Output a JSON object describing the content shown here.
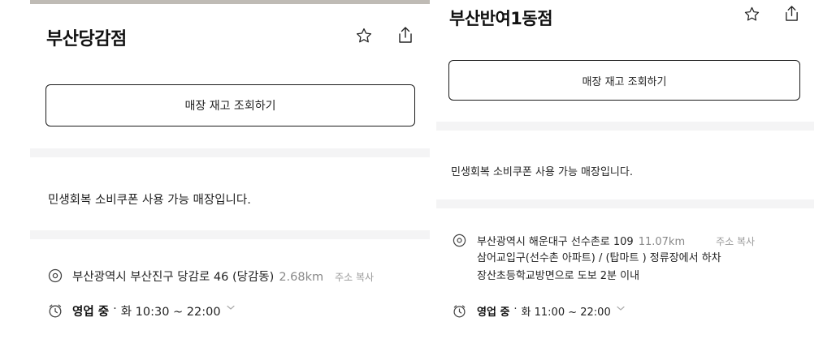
{
  "stores": [
    {
      "name": "부산당감점",
      "inventory_button": "매장 재고 조회하기",
      "coupon_notice": "민생회복 소비쿠폰 사용 가능 매장입니다.",
      "address": "부산광역시 부산진구 당감로 46 (당감동)",
      "distance": "2.68km",
      "copy_label": "주소 복사",
      "directions_1": "",
      "directions_2": "",
      "hours_status": "영업 중",
      "hours_separator": "·",
      "hours": "화 10:30 ~ 22:00"
    },
    {
      "name": "부산반여1동점",
      "inventory_button": "매장 재고 조회하기",
      "coupon_notice": "민생회복 소비쿠폰 사용 가능 매장입니다.",
      "address": "부산광역시 해운대구 선수촌로 109",
      "distance": "11.07km",
      "copy_label": "주소 복사",
      "directions_1": "삼어교입구(선수촌 아파트) / (탑마트 ) 정류장에서 하차",
      "directions_2": "장산초등학교방면으로 도보 2분 이내",
      "hours_status": "영업 중",
      "hours_separator": "·",
      "hours": "화 11:00 ~ 22:00"
    }
  ],
  "icons": {
    "star": "star-outline-icon",
    "share": "share-icon",
    "location": "location-pin-icon",
    "clock": "clock-icon",
    "chevron": "chevron-down-icon"
  },
  "colors": {
    "divider": "#f4f4f5",
    "muted_text": "#888888",
    "border": "#1a1a1a"
  }
}
